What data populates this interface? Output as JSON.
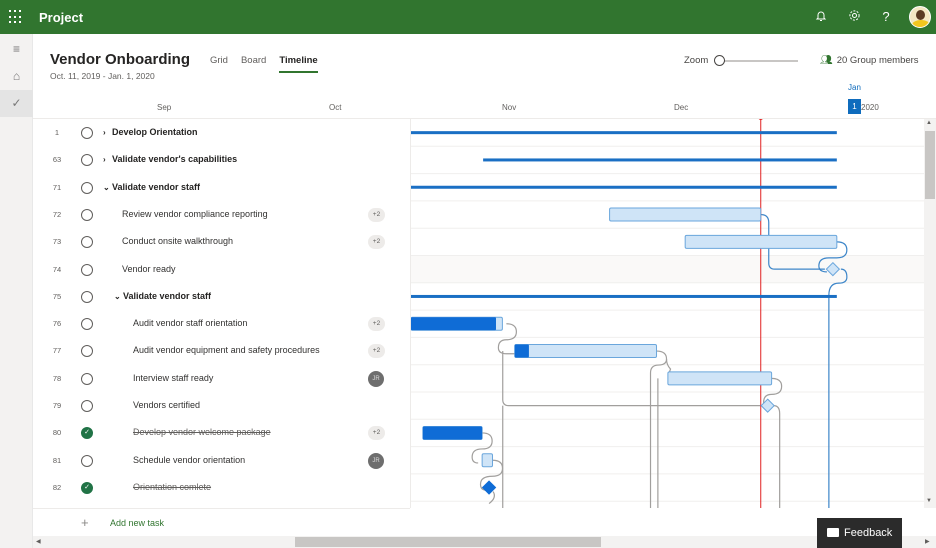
{
  "app": {
    "name": "Project",
    "top_icons": [
      "app-launcher-icon",
      "bell-icon",
      "gear-icon",
      "help-icon",
      "avatar"
    ]
  },
  "rail": {
    "items": [
      {
        "name": "menu",
        "icon": "hamburger-icon",
        "glyph": "≡"
      },
      {
        "name": "home",
        "icon": "home-icon",
        "glyph": "⌂"
      },
      {
        "name": "tasks",
        "icon": "checkmark-icon",
        "glyph": "✓",
        "active": true
      }
    ]
  },
  "header": {
    "title": "Vendor Onboarding",
    "date_range": "Oct. 11, 2019 - Jan. 1, 2020",
    "tabs": [
      {
        "label": "Grid",
        "active": false
      },
      {
        "label": "Board",
        "active": false
      },
      {
        "label": "Timeline",
        "active": true
      }
    ],
    "zoom_label": "Zoom",
    "zoom_level": 0,
    "members_label": "20 Group members"
  },
  "timeline": {
    "months": [
      "Sep",
      "Oct",
      "Nov",
      "Dec"
    ],
    "today_month": "Jan",
    "today_day": "1",
    "today_year": "2020"
  },
  "tasks": [
    {
      "id": "1",
      "name": "Develop Orientation",
      "bold": true,
      "caret": "›",
      "indent": 0,
      "done": false,
      "assignee": ""
    },
    {
      "id": "63",
      "name": "Validate vendor's capabilities",
      "bold": true,
      "caret": "›",
      "indent": 0,
      "done": false,
      "assignee": ""
    },
    {
      "id": "71",
      "name": "Validate vendor staff",
      "bold": true,
      "caret": "⌄",
      "indent": 0,
      "done": false,
      "assignee": ""
    },
    {
      "id": "72",
      "name": "Review vendor compliance reporting",
      "bold": false,
      "caret": "",
      "indent": 1,
      "done": false,
      "assignee": "+2"
    },
    {
      "id": "73",
      "name": "Conduct onsite walkthrough",
      "bold": false,
      "caret": "",
      "indent": 1,
      "done": false,
      "assignee": "+2"
    },
    {
      "id": "74",
      "name": "Vendor ready",
      "bold": false,
      "caret": "",
      "indent": 1,
      "done": false,
      "assignee": ""
    },
    {
      "id": "75",
      "name": "Validate vendor staff",
      "bold": true,
      "caret": "⌄",
      "indent": 1,
      "done": false,
      "assignee": ""
    },
    {
      "id": "76",
      "name": "Audit vendor staff orientation",
      "bold": false,
      "caret": "",
      "indent": 2,
      "done": false,
      "assignee": "+2"
    },
    {
      "id": "77",
      "name": "Audit vendor equipment and safety procedures",
      "bold": false,
      "caret": "",
      "indent": 2,
      "done": false,
      "assignee": "+2"
    },
    {
      "id": "78",
      "name": "Interview staff ready",
      "bold": false,
      "caret": "",
      "indent": 2,
      "done": false,
      "assignee": "JR"
    },
    {
      "id": "79",
      "name": "Vendors certified",
      "bold": false,
      "caret": "",
      "indent": 2,
      "done": false,
      "assignee": ""
    },
    {
      "id": "80",
      "name": "Develop vendor welcome package",
      "bold": false,
      "caret": "",
      "indent": 2,
      "done": true,
      "assignee": "+2"
    },
    {
      "id": "81",
      "name": "Schedule vendor orientation",
      "bold": false,
      "caret": "",
      "indent": 2,
      "done": false,
      "assignee": "JR"
    },
    {
      "id": "82",
      "name": "Orientation comlete",
      "bold": false,
      "caret": "",
      "indent": 2,
      "done": true,
      "assignee": ""
    }
  ],
  "gantt": {
    "colors": {
      "summary": "#1a6fc4",
      "bar_fill": "#cfe4f7",
      "bar_border": "#6aa6dc",
      "progress": "#0f6cd6",
      "today": "#e02020",
      "link_active": "#3d86c9",
      "link": "#a19f9d"
    },
    "bars": [
      {
        "row": 0,
        "type": "summary",
        "start": 0.0,
        "end": 0.862
      },
      {
        "row": 1,
        "type": "summary",
        "start": 0.146,
        "end": 0.862
      },
      {
        "row": 2,
        "type": "summary",
        "start": 0.0,
        "end": 0.862
      },
      {
        "row": 3,
        "type": "task",
        "start": 0.402,
        "end": 0.708,
        "progress": 0
      },
      {
        "row": 4,
        "type": "task",
        "start": 0.555,
        "end": 0.862,
        "progress": 0
      },
      {
        "row": 5,
        "type": "milestone",
        "at": 0.854,
        "filled": false
      },
      {
        "row": 6,
        "type": "summary",
        "start": 0.0,
        "end": 0.862
      },
      {
        "row": 7,
        "type": "task",
        "start": 0.0,
        "end": 0.185,
        "progress": 0.93
      },
      {
        "row": 8,
        "type": "task",
        "start": 0.21,
        "end": 0.497,
        "progress": 0.1
      },
      {
        "row": 9,
        "type": "task",
        "start": 0.52,
        "end": 0.73,
        "progress": 0
      },
      {
        "row": 10,
        "type": "milestone",
        "at": 0.722,
        "filled": false
      },
      {
        "row": 11,
        "type": "task",
        "start": 0.024,
        "end": 0.144,
        "progress": 1
      },
      {
        "row": 12,
        "type": "task",
        "start": 0.144,
        "end": 0.165,
        "progress": 0
      },
      {
        "row": 13,
        "type": "milestone",
        "at": 0.158,
        "filled": true
      }
    ],
    "today_at": 0.708,
    "highlighted_row": 5
  },
  "footer": {
    "add_task": "Add new task",
    "feedback": "Feedback"
  }
}
